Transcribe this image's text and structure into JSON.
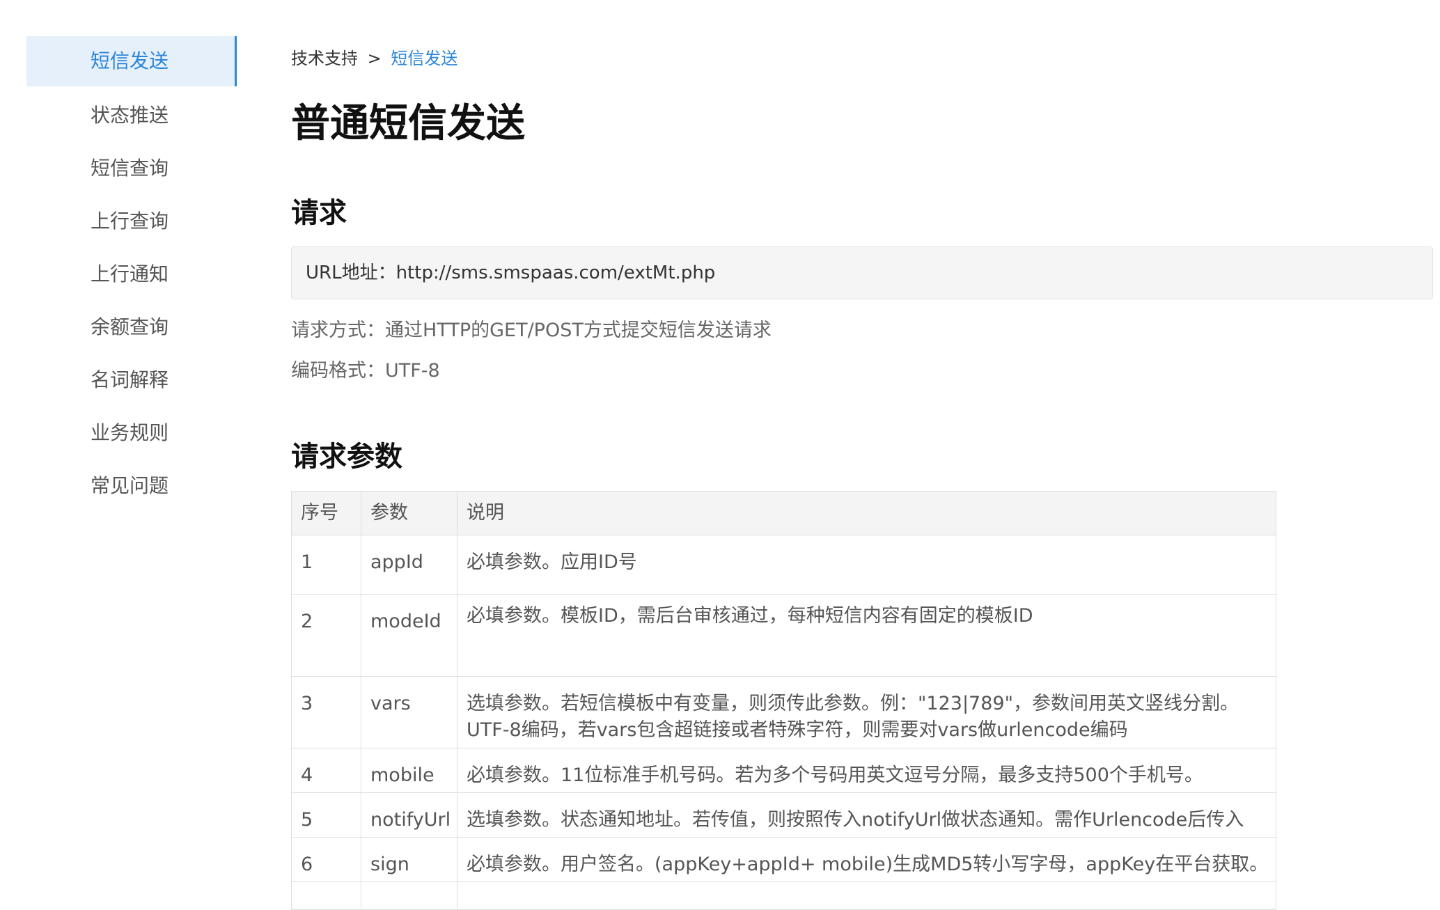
{
  "sidebar": {
    "items": [
      {
        "label": "短信发送"
      },
      {
        "label": "状态推送"
      },
      {
        "label": "短信查询"
      },
      {
        "label": "上行查询"
      },
      {
        "label": "上行通知"
      },
      {
        "label": "余额查询"
      },
      {
        "label": "名词解释"
      },
      {
        "label": "业务规则"
      },
      {
        "label": "常见问题"
      }
    ],
    "active_color": "#2b86d8"
  },
  "breadcrumb": {
    "parent": "技术支持",
    "separator": ">",
    "current": "短信发送"
  },
  "page_title": "普通短信发送",
  "request": {
    "heading": "请求",
    "url_line": "URL地址：http://sms.smspaas.com/extMt.php",
    "method_line": "请求方式：通过HTTP的GET/POST方式提交短信发送请求",
    "encoding_line": "编码格式：UTF-8"
  },
  "params": {
    "heading": "请求参数",
    "columns": [
      "序号",
      "参数",
      "说明"
    ],
    "rows": [
      {
        "no": "1",
        "name": "appId",
        "desc": "必填参数。应用ID号"
      },
      {
        "no": "2",
        "name": "modeId",
        "desc": "必填参数。模板ID，需后台审核通过，每种短信内容有固定的模板ID"
      },
      {
        "no": "3",
        "name": "vars",
        "desc": "选填参数。若短信模板中有变量，则须传此参数。例：\"123|789\"，参数间用英文竖线分割。UTF-8编码，若vars包含超链接或者特殊字符，则需要对vars做urlencode编码"
      },
      {
        "no": "4",
        "name": "mobile",
        "desc": "必填参数。11位标准手机号码。若为多个号码用英文逗号分隔，最多支持500个手机号。"
      },
      {
        "no": "5",
        "name": "notifyUrl",
        "desc": "选填参数。状态通知地址。若传值，则按照传入notifyUrl做状态通知。需作Urlencode后传入"
      },
      {
        "no": "6",
        "name": "sign",
        "desc": "必填参数。用户签名。(appKey+appId+ mobile)生成MD5转小写字母，appKey在平台获取。"
      }
    ]
  }
}
